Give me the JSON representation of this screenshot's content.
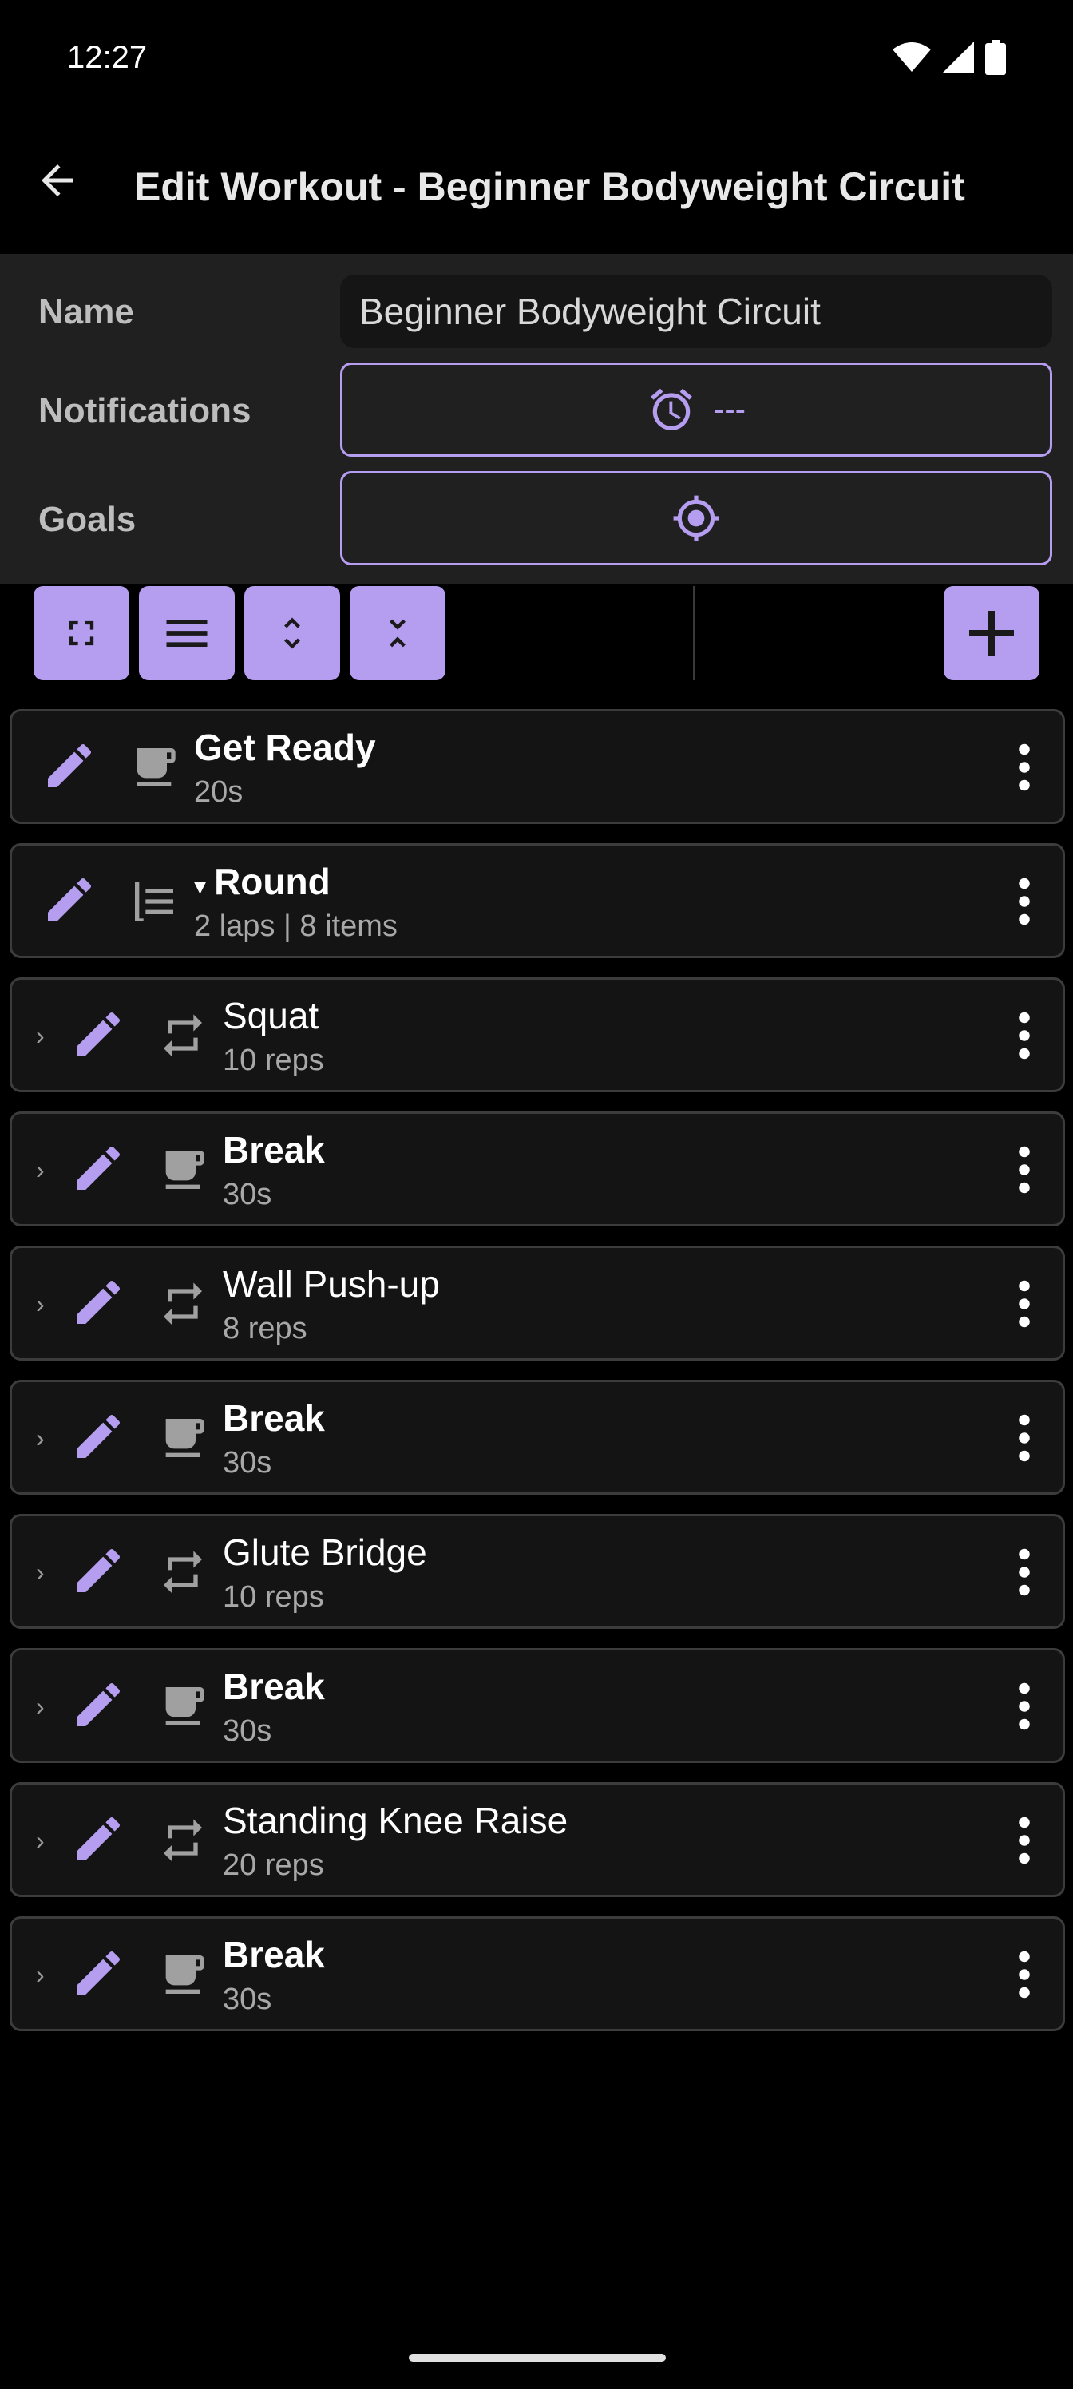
{
  "status": {
    "time": "12:27"
  },
  "header": {
    "title": "Edit Workout - Beginner Bodyweight Circuit"
  },
  "form": {
    "name_label": "Name",
    "name_value": "Beginner Bodyweight Circuit",
    "notifications_label": "Notifications",
    "notifications_value": "---",
    "goals_label": "Goals"
  },
  "toolbar": {
    "buttons": [
      "fullscreen-icon",
      "list-icon",
      "expand-icon",
      "collapse-icon"
    ],
    "add": "plus-icon"
  },
  "items": [
    {
      "title": "Get Ready",
      "subtitle": "20s",
      "kind": "break",
      "bold": true,
      "indent": false
    },
    {
      "title": "Round",
      "subtitle": "2 laps | 8 items",
      "kind": "group",
      "bold": true,
      "indent": false,
      "caret": "▾"
    },
    {
      "title": "Squat",
      "subtitle": "10 reps",
      "kind": "repeat",
      "bold": false,
      "indent": true
    },
    {
      "title": "Break",
      "subtitle": "30s",
      "kind": "break",
      "bold": true,
      "indent": true
    },
    {
      "title": "Wall Push-up",
      "subtitle": "8 reps",
      "kind": "repeat",
      "bold": false,
      "indent": true
    },
    {
      "title": "Break",
      "subtitle": "30s",
      "kind": "break",
      "bold": true,
      "indent": true
    },
    {
      "title": "Glute Bridge",
      "subtitle": "10 reps",
      "kind": "repeat",
      "bold": false,
      "indent": true
    },
    {
      "title": "Break",
      "subtitle": "30s",
      "kind": "break",
      "bold": true,
      "indent": true
    },
    {
      "title": "Standing Knee Raise",
      "subtitle": "20 reps",
      "kind": "repeat",
      "bold": false,
      "indent": true
    },
    {
      "title": "Break",
      "subtitle": "30s",
      "kind": "break",
      "bold": true,
      "indent": true
    }
  ],
  "colors": {
    "accent": "#b59df0",
    "background": "#000000",
    "panel": "#202020",
    "row": "#141414"
  }
}
